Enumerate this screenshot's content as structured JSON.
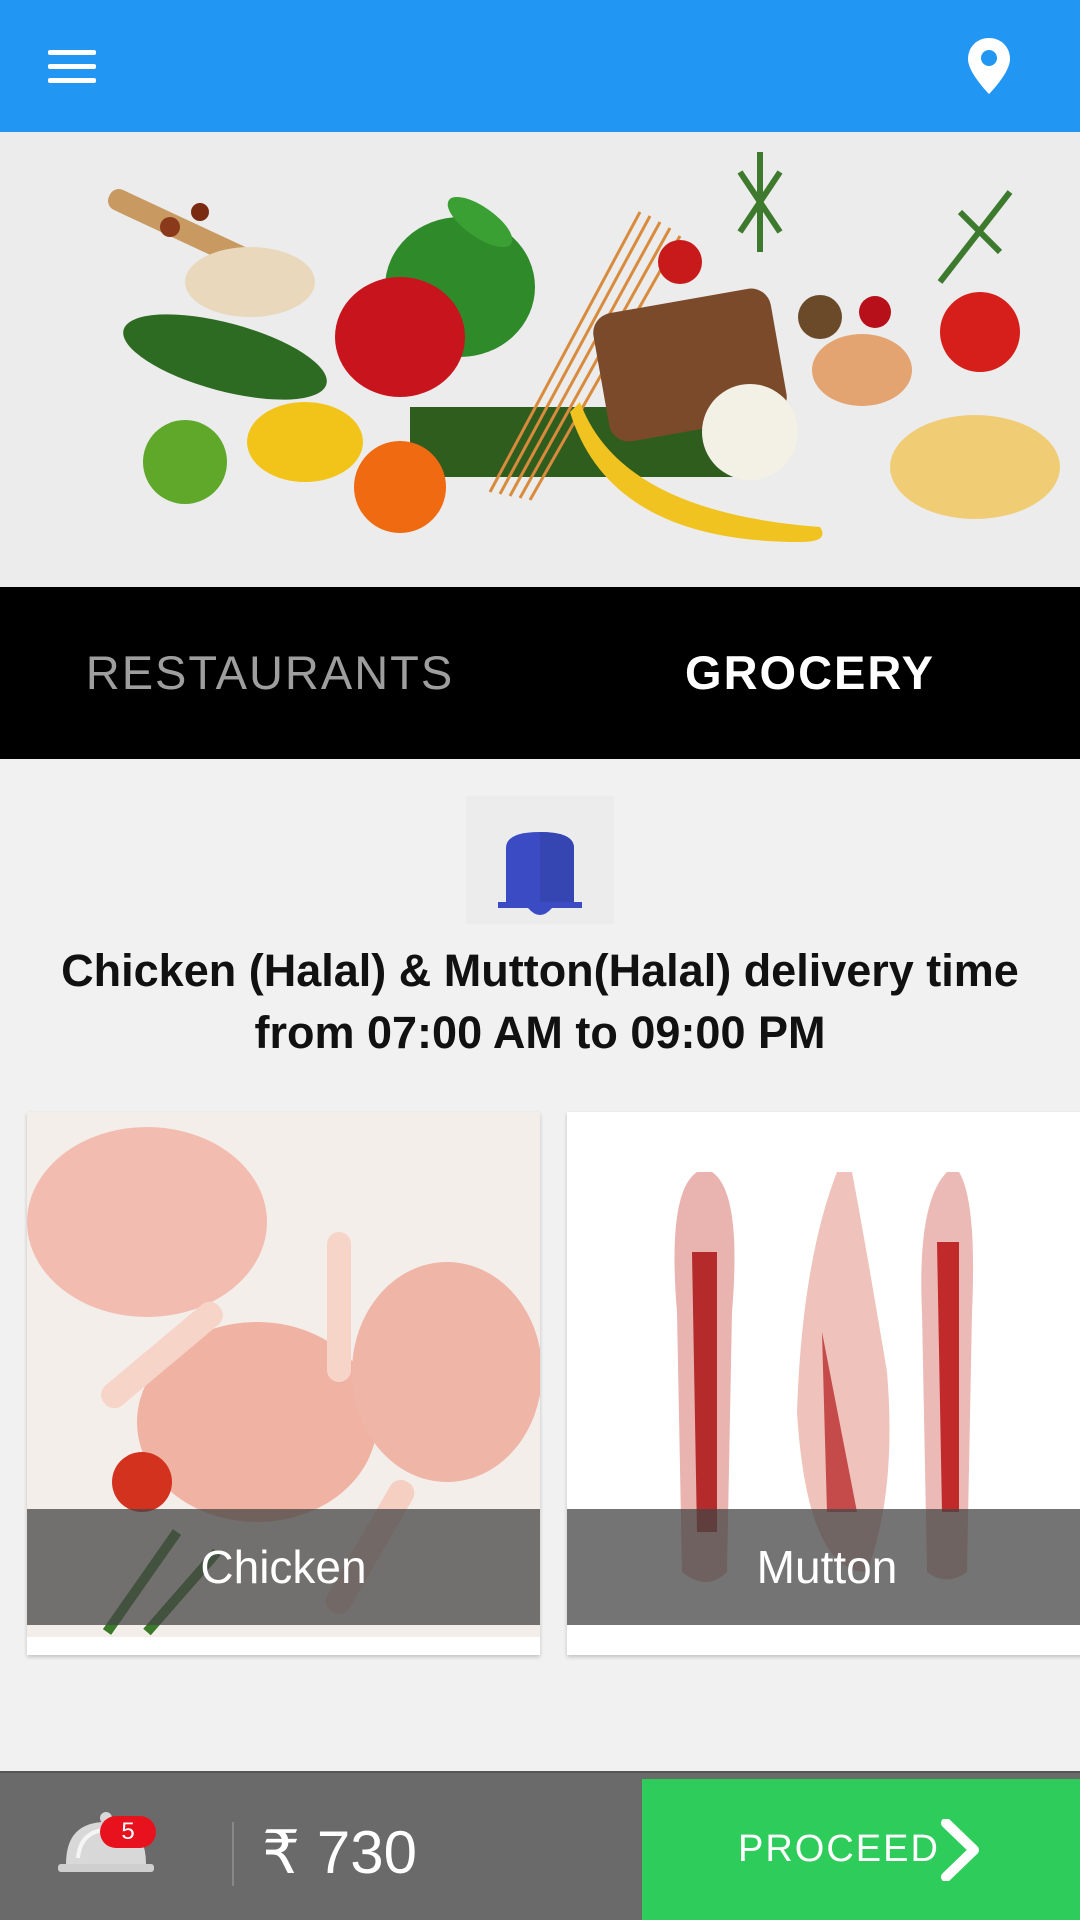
{
  "tabs": [
    {
      "label": "RESTAURANTS",
      "active": false
    },
    {
      "label": "GROCERY",
      "active": true
    }
  ],
  "notice": {
    "line1": "Chicken (Halal) & Mutton(Halal) delivery time",
    "line2": "from 07:00 AM to 09:00 PM"
  },
  "categories": [
    {
      "label": "Chicken"
    },
    {
      "label": "Mutton"
    }
  ],
  "cart": {
    "count": "5",
    "total": "₹ 730"
  },
  "proceed_label": "PROCEED",
  "colors": {
    "appbar": "#2196f3",
    "bell": "#3a4bc4",
    "proceed": "#2ecc5b",
    "badge": "#e8121e"
  }
}
